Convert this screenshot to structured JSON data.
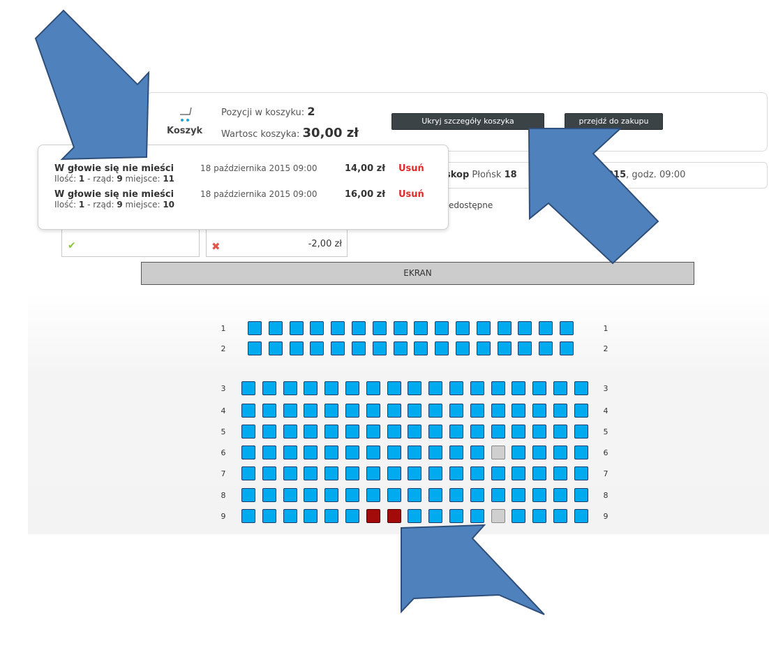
{
  "cart": {
    "label": "Koszyk",
    "positions_label": "Pozycji w koszyku: ",
    "positions_count": "2",
    "value_label": "Wartosc koszyka: ",
    "value_amount": "30,00 zł",
    "hide_details_button": "Ukryj szczegóły koszyka",
    "checkout_button": "przejdź do zakupu",
    "items": [
      {
        "title": "W głowie się nie mieści",
        "date": "18 października 2015 09:00",
        "price": "14,00 zł",
        "remove": "Usuń",
        "qty_label": "Ilość: ",
        "qty": "1",
        "row_label": " - rząd: ",
        "row": "9",
        "seat_label": " miejsce: ",
        "seat": "11"
      },
      {
        "title": "W głowie się nie mieści",
        "date": "18 października 2015 09:00",
        "price": "16,00 zł",
        "remove": "Usuń",
        "qty_label": "Ilość: ",
        "qty": "1",
        "row_label": " - rząd: ",
        "row": "9",
        "seat_label": " miejsce: ",
        "seat": "10"
      }
    ]
  },
  "event": {
    "cinema_bold": "skop",
    "cinema_rest": " Płońsk ",
    "cinema_date_bold": "18",
    "date_bold": "015",
    "date_rest": ", godz. 09:00"
  },
  "legend": {
    "unavailable": "niedostępne"
  },
  "discounts": {
    "price": "-2,00 zł"
  },
  "screen_label": "EKRAN",
  "seatmap": {
    "rows": [
      {
        "label": "1",
        "seats": 16,
        "unavailable": [],
        "selected": []
      },
      {
        "label": "2",
        "seats": 16,
        "unavailable": [],
        "selected": []
      },
      {
        "label": "3",
        "seats": 17,
        "unavailable": [],
        "selected": []
      },
      {
        "label": "4",
        "seats": 17,
        "unavailable": [],
        "selected": []
      },
      {
        "label": "5",
        "seats": 17,
        "unavailable": [],
        "selected": []
      },
      {
        "label": "6",
        "seats": 17,
        "unavailable": [
          12
        ],
        "selected": []
      },
      {
        "label": "7",
        "seats": 17,
        "unavailable": [],
        "selected": []
      },
      {
        "label": "8",
        "seats": 17,
        "unavailable": [],
        "selected": []
      },
      {
        "label": "9",
        "seats": 17,
        "unavailable": [
          12
        ],
        "selected": [
          6,
          7
        ]
      }
    ]
  },
  "colors": {
    "seat_free": "#00aaee",
    "seat_selected": "#a30b0b",
    "seat_unavailable": "#cfcfcf",
    "arrow": "#4f81bd",
    "remove_link": "#e02a2a"
  }
}
